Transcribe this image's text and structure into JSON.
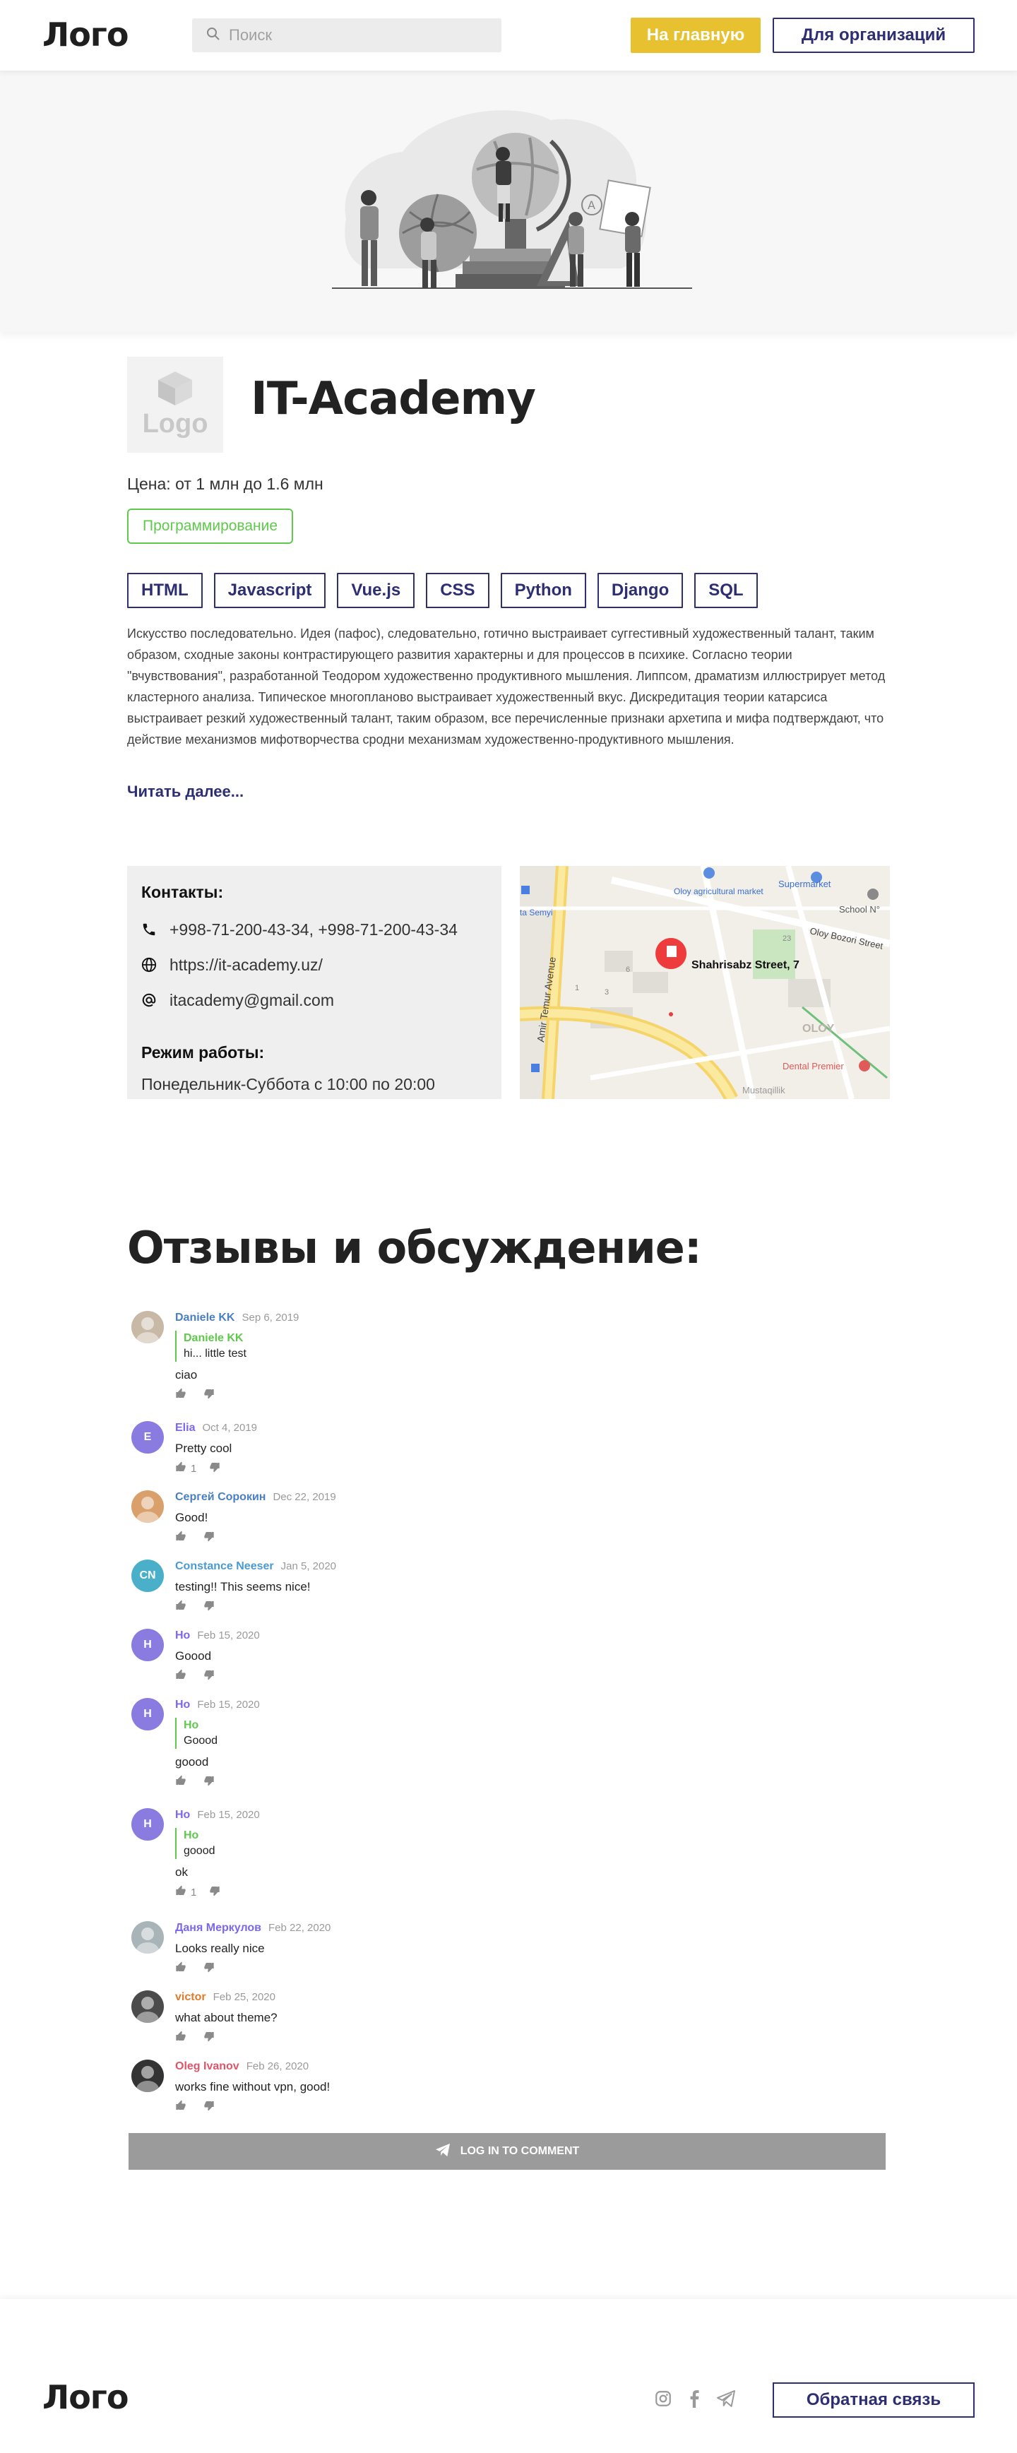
{
  "header": {
    "logo": "Лого",
    "search_placeholder": "Поиск",
    "home_button": "На главную",
    "org_button": "Для организаций"
  },
  "org": {
    "logo_placeholder": "Logo",
    "title": "IT-Academy",
    "price": "Цена: от 1 млн до 1.6 млн",
    "category": "Программирование",
    "tags": [
      "HTML",
      "Javascript",
      "Vue.js",
      "CSS",
      "Python",
      "Django",
      "SQL"
    ],
    "description": "Искусство последовательно. Идея (пафос), следовательно, готично выстраивает суггестивный художественный талант, таким образом, сходные законы контрастирующего развития характерны и для процессов в психике. Согласно теории \"вчувствования\", разработанной Теодором художественно продуктивного мышления. Липпсом, драматизм иллюстрирует метод кластерного анализа. Типическое многопланово выстраивает художественный вкус. Дискредитация теории катарсиса выстраивает резкий художественный талант, таким образом, все перечисленные признаки архетипа и мифа подтверждают, что действие механизмов мифотворчества сродни механизмам художественно-продуктивного мышления.",
    "read_more": "Читать далее..."
  },
  "contacts": {
    "title": "Контакты:",
    "phone": "+998-71-200-43-34, +998-71-200-43-34",
    "website": "https://it-academy.uz/",
    "email": "itacademy@gmail.com",
    "work_title": "Режим работы:",
    "work_hours": "Понедельник-Суббота с 10:00 по 20:00"
  },
  "map": {
    "address": "Shahrisabz Street, 7",
    "labels": {
      "supermarket": "Supermarket",
      "school": "School N°",
      "oloy_market": "Oloy agricultural market",
      "oloy_bozori": "Oloy Bozori Street",
      "amir": "Amir Temur Avenue",
      "semyi": "ta Semyi",
      "oloy": "OLOY",
      "dental": "Dental Premier",
      "mustaqillik": "Mustaqillik",
      "num_23": "23",
      "num_6": "6",
      "num_3": "3",
      "num_1": "1"
    }
  },
  "reviews": {
    "title": "Отзывы и обсуждение:",
    "comments": [
      {
        "author": "Daniele KK",
        "date": "Sep 6, 2019",
        "quote_author": "Daniele KK",
        "quote_text": "hi... little test",
        "text": "ciao",
        "likes": "",
        "initials": "",
        "color": "#4a7fc1"
      },
      {
        "author": "Elia",
        "date": "Oct 4, 2019",
        "text": "Pretty cool",
        "likes": "1",
        "initials": "E",
        "color": "#7b68ee"
      },
      {
        "author": "Сергей Сорокин",
        "date": "Dec 22, 2019",
        "text": "Good!",
        "likes": "",
        "initials": "",
        "color": "#4a7fc1"
      },
      {
        "author": "Constance Neeser",
        "date": "Jan 5, 2020",
        "text": "testing!! This seems nice!",
        "likes": "",
        "initials": "CN",
        "color": "#4a9ad1"
      },
      {
        "author": "Ho",
        "date": "Feb 15, 2020",
        "text": "Goood",
        "likes": "",
        "initials": "H",
        "color": "#7b68ee"
      },
      {
        "author": "Ho",
        "date": "Feb 15, 2020",
        "quote_author": "Ho",
        "quote_text": "Goood",
        "text": "goood",
        "likes": "",
        "initials": "H",
        "color": "#7b68ee"
      },
      {
        "author": "Ho",
        "date": "Feb 15, 2020",
        "quote_author": "Ho",
        "quote_text": "goood",
        "text": "ok",
        "likes": "1",
        "initials": "H",
        "color": "#7b68ee"
      },
      {
        "author": "Даня Меркулов",
        "date": "Feb 22, 2020",
        "text": "Looks really nice",
        "likes": "",
        "initials": "",
        "color": "#7b68ee"
      },
      {
        "author": "victor",
        "date": "Feb 25, 2020",
        "text": "what about theme?",
        "likes": "",
        "initials": "",
        "color": "#e07b2c"
      },
      {
        "author": "Oleg Ivanov",
        "date": "Feb 26, 2020",
        "text": "works fine without vpn, good!",
        "likes": "",
        "initials": "",
        "color": "#e0556a"
      }
    ],
    "login_button": "LOG IN TO COMMENT"
  },
  "footer": {
    "logo": "Лого",
    "feedback_button": "Обратная связь"
  },
  "colors": {
    "accent_yellow": "#e8c130",
    "brand_navy": "#2d2f72",
    "category_green": "#5fc94c"
  }
}
